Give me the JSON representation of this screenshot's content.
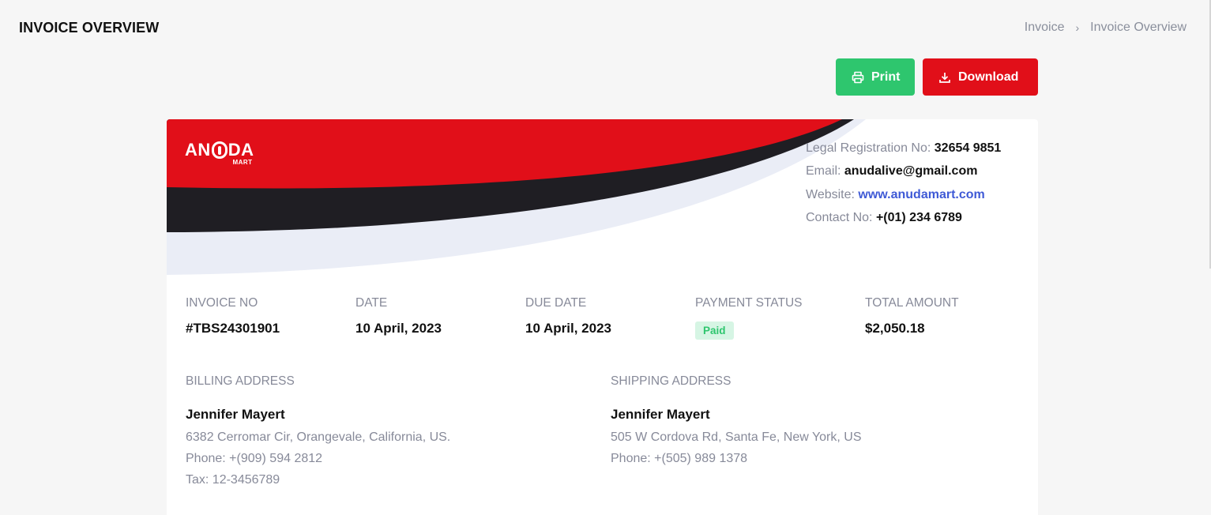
{
  "header": {
    "title": "INVOICE OVERVIEW",
    "breadcrumb": [
      "Invoice",
      "Invoice Overview"
    ]
  },
  "actions": {
    "print_label": "Print",
    "download_label": "Download"
  },
  "colors": {
    "brand_red": "#e10f19",
    "print_green": "#2ec66e",
    "dark_band": "#1f1e23",
    "light_band": "#eaedf6",
    "link_blue": "#3f5ad6"
  },
  "logo": {
    "text_a": "AN",
    "text_b": "DA",
    "sub": "MART"
  },
  "company": {
    "registration_label": "Legal Registration No:",
    "registration_value": "32654 9851",
    "email_label": "Email:",
    "email_value": "anudalive@gmail.com",
    "website_label": "Website:",
    "website_value": "www.anudamart.com",
    "contact_label": "Contact No:",
    "contact_value": "+(01) 234 6789"
  },
  "invoice": {
    "number_label": "INVOICE NO",
    "number_value": "#TBS24301901",
    "date_label": "DATE",
    "date_value": "10 April, 2023",
    "due_label": "DUE DATE",
    "due_value": "10 April, 2023",
    "status_label": "PAYMENT STATUS",
    "status_value": "Paid",
    "total_label": "TOTAL AMOUNT",
    "total_value": "$2,050.18"
  },
  "billing": {
    "label": "BILLING ADDRESS",
    "name": "Jennifer Mayert",
    "address": "6382 Cerromar Cir, Orangevale, California, US.",
    "phone": "Phone: +(909) 594 2812",
    "tax": "Tax: 12-3456789"
  },
  "shipping": {
    "label": "SHIPPING ADDRESS",
    "name": "Jennifer Mayert",
    "address": "505 W Cordova Rd, Santa Fe, New York, US",
    "phone": "Phone: +(505) 989 1378"
  }
}
